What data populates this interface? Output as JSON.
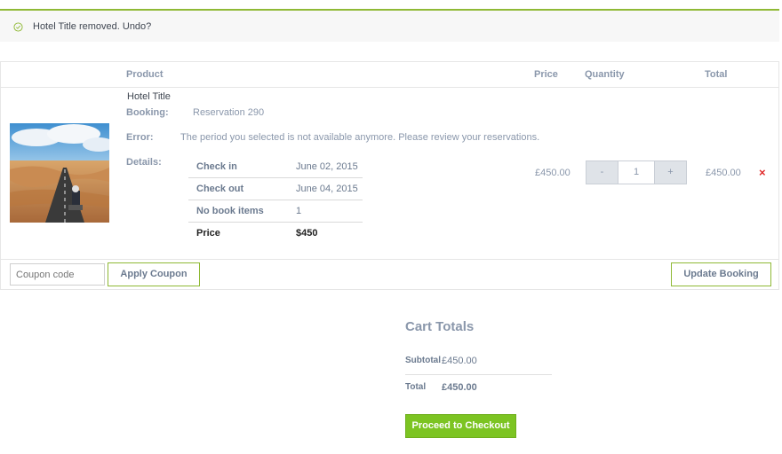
{
  "notice": {
    "message": "Hotel Title removed. Undo?"
  },
  "table": {
    "headers": {
      "product": "Product",
      "price": "Price",
      "quantity": "Quantity",
      "total": "Total"
    },
    "item": {
      "title": "Hotel Title",
      "booking_label": "Booking:",
      "booking_value": "Reservation 290",
      "error_label": "Error:",
      "error_value": "The period you selected is not available anymore. Please review your reservations.",
      "details_label": "Details:",
      "details": [
        {
          "key": "Check in",
          "value": "June 02, 2015"
        },
        {
          "key": "Check out",
          "value": "June 04, 2015"
        },
        {
          "key": "No book items",
          "value": "1"
        },
        {
          "key": "Price",
          "value": "$450"
        }
      ],
      "price": "£450.00",
      "quantity": {
        "minus": "-",
        "value": "1",
        "plus": "+"
      },
      "total": "£450.00",
      "remove": "×"
    }
  },
  "actions": {
    "coupon_placeholder": "Coupon code",
    "apply_coupon": "Apply Coupon",
    "update_booking": "Update Booking"
  },
  "cart_totals": {
    "title": "Cart Totals",
    "subtotal_label": "Subtotal",
    "subtotal_value": "£450.00",
    "total_label": "Total",
    "total_value": "£450.00",
    "checkout": "Proceed to Checkout"
  },
  "colors": {
    "accent": "#8fb935",
    "checkout": "#7cc422",
    "remove": "#e02a2a"
  }
}
